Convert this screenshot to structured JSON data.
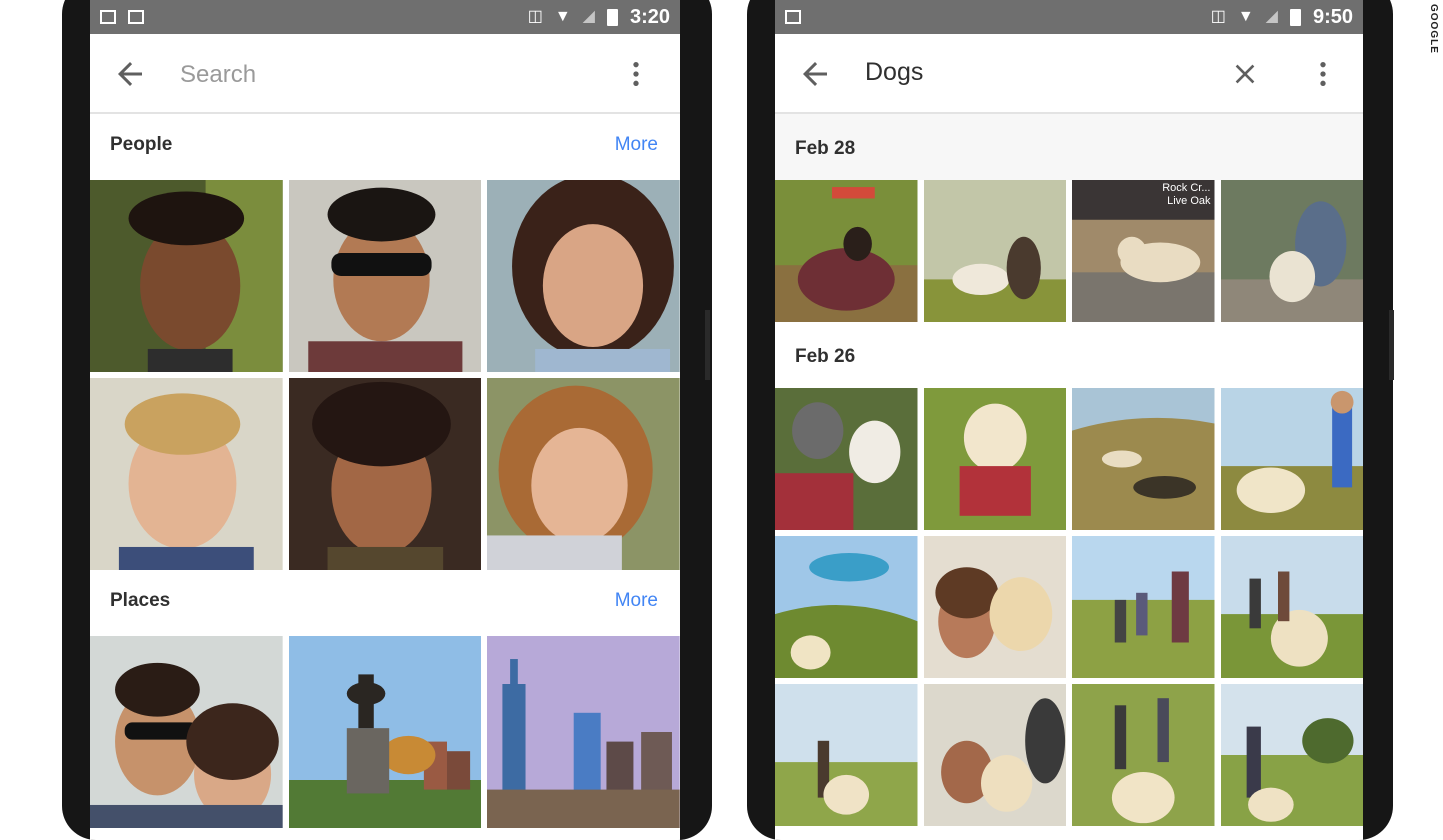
{
  "left": {
    "status": {
      "time": "3:20"
    },
    "search": {
      "placeholder": "Search"
    },
    "people": {
      "title": "People",
      "more": "More"
    },
    "places": {
      "title": "Places",
      "more": "More"
    }
  },
  "right": {
    "status": {
      "time": "9:50"
    },
    "query": "Dogs",
    "groups": [
      {
        "date": "Feb 28",
        "overlay_text": "Rock Cr... Live Oak"
      },
      {
        "date": "Feb 26"
      }
    ]
  },
  "watermark": "GOOGLE",
  "colors": {
    "accent": "#4285f4",
    "statusbar": "#6f6f6f"
  }
}
